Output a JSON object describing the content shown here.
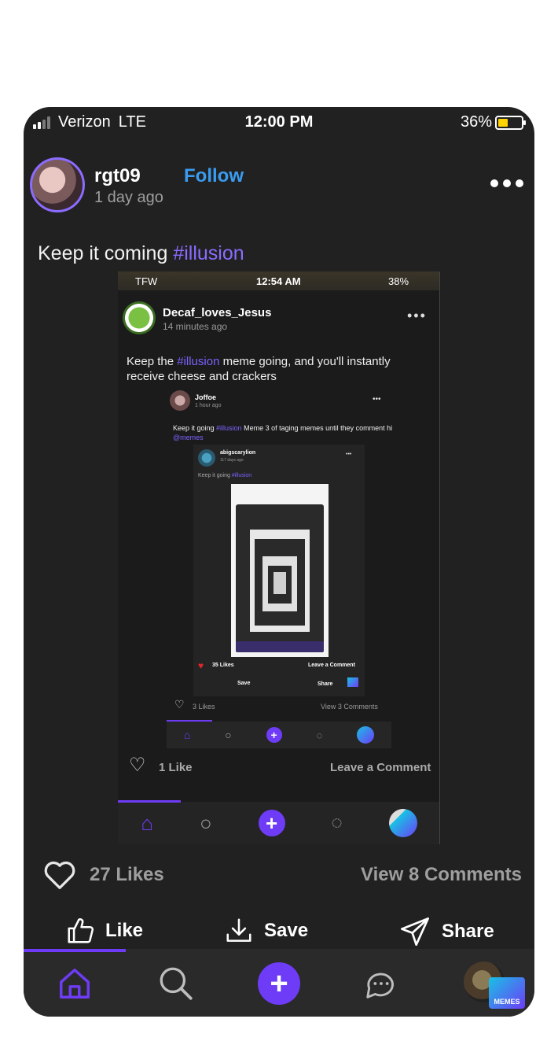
{
  "status_bar": {
    "carrier": "Verizon",
    "network": "LTE",
    "time": "12:00 PM",
    "battery": "36%"
  },
  "post": {
    "username": "rgt09",
    "follow_label": "Follow",
    "time_ago": "1 day ago",
    "caption_text": "Keep it coming ",
    "caption_tag": "#illusion",
    "likes": "27 Likes",
    "comments": "View 8 Comments"
  },
  "embedded": {
    "status": {
      "carrier": "TFW",
      "time": "12:54 AM",
      "battery": "38%"
    },
    "username": "Decaf_loves_Jesus",
    "time_ago": "14 minutes ago",
    "caption_before": "Keep the ",
    "caption_tag": "#illusion",
    "caption_after": " meme going, and you'll instantly receive cheese and crackers",
    "likes": "1 Like",
    "comment_link": "Leave a Comment",
    "nested": {
      "username": "Joffoe",
      "time_ago": "1 hour ago",
      "caption_before": "Keep it going ",
      "caption_tag": "#illusion",
      "caption_mid": " Meme 3 of taging memes until they comment hi ",
      "caption_mention": "@memes",
      "likes": "3 Likes",
      "comments": "View 3 Comments",
      "inner": {
        "username": "abigscarylion",
        "time_ago": "117 days ago",
        "caption_before": "Keep it going ",
        "caption_tag": "#illusion",
        "likes": "35 Likes",
        "comment_link": "Leave a Comment",
        "save": "Save",
        "share": "Share"
      }
    }
  },
  "actions": {
    "like": "Like",
    "save": "Save",
    "share": "Share"
  },
  "nav": {
    "badge": "MEMES"
  },
  "colors": {
    "accent": "#6e3cf7",
    "follow": "#3a9cf0",
    "background": "#212121"
  }
}
